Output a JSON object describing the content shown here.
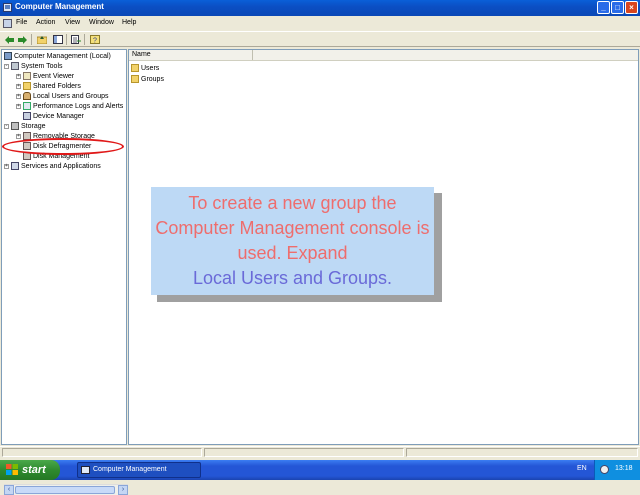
{
  "window": {
    "title": "Computer Management"
  },
  "menu": {
    "items": [
      "File",
      "Action",
      "View",
      "Window",
      "Help"
    ]
  },
  "toolbar": {
    "icons": [
      "back-arrow-icon",
      "forward-arrow-icon",
      "up-folder-icon",
      "show-hide-tree-icon",
      "export-list-icon",
      "help-icon"
    ]
  },
  "tree": {
    "items": [
      {
        "label": "Computer Management (Local)",
        "icon": "computer-management-icon",
        "expander": ""
      },
      {
        "label": "System Tools",
        "icon": "system-tools-icon",
        "expander": "-"
      },
      {
        "label": "Event Viewer",
        "icon": "event-viewer-icon",
        "expander": "+"
      },
      {
        "label": "Shared Folders",
        "icon": "shared-folders-icon",
        "expander": "+"
      },
      {
        "label": "Local Users and Groups",
        "icon": "local-users-groups-icon",
        "expander": "+"
      },
      {
        "label": "Performance Logs and Alerts",
        "icon": "performance-logs-icon",
        "expander": "+"
      },
      {
        "label": "Device Manager",
        "icon": "device-manager-icon",
        "expander": ""
      },
      {
        "label": "Storage",
        "icon": "storage-icon",
        "expander": "-"
      },
      {
        "label": "Removable Storage",
        "icon": "removable-storage-icon",
        "expander": "+"
      },
      {
        "label": "Disk Defragmenter",
        "icon": "disk-defragmenter-icon",
        "expander": ""
      },
      {
        "label": "Disk Management",
        "icon": "disk-management-icon",
        "expander": ""
      },
      {
        "label": "Services and Applications",
        "icon": "services-applications-icon",
        "expander": "+"
      }
    ]
  },
  "list": {
    "column_name": "Name",
    "items": [
      {
        "label": "Users",
        "icon": "folder-icon"
      },
      {
        "label": "Groups",
        "icon": "folder-icon"
      }
    ]
  },
  "callout": {
    "text_red": "To create a new group the Computer Management console is used. Expand",
    "text_blue": "Local Users and Groups."
  },
  "taskbar": {
    "start_label": "start",
    "task_label": "Computer Management",
    "language": "EN",
    "clock": "13:18"
  },
  "colors": {
    "callout_bg": "#bdd9f5",
    "callout_red": "#ee6d6d",
    "callout_blue": "#6a6ad8",
    "highlight_ellipse": "#e01818"
  }
}
